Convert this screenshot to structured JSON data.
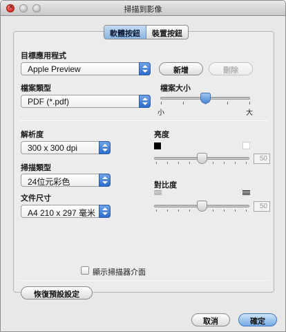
{
  "window": {
    "title": "掃描到影像"
  },
  "tabs": [
    {
      "label": "軟體按鈕",
      "selected": true
    },
    {
      "label": "裝置按鈕",
      "selected": false
    }
  ],
  "target_app": {
    "label": "目標應用程式",
    "value": "Apple Preview",
    "add_button": "新增",
    "delete_button": "刪除"
  },
  "file_type": {
    "label": "檔案類型",
    "value": "PDF (*.pdf)"
  },
  "file_size": {
    "label": "檔案大小",
    "small_label": "小",
    "large_label": "大",
    "level": 0.45
  },
  "resolution": {
    "label": "解析度",
    "value": "300 x 300 dpi"
  },
  "scan_type": {
    "label": "掃描類型",
    "value": "24位元彩色"
  },
  "document_size": {
    "label": "文件尺寸",
    "value": "A4  210 x 297 毫米"
  },
  "brightness": {
    "label": "亮度",
    "value": "50"
  },
  "contrast": {
    "label": "對比度",
    "value": "50"
  },
  "show_scanner_interface": {
    "label": "顯示掃描器介面",
    "checked": false
  },
  "restore_defaults": "恢復預設設定",
  "footer": {
    "cancel": "取消",
    "ok": "確定"
  },
  "colors": {
    "accent": "#4a86d4",
    "window_bg": "#e8e8e8"
  },
  "icons": [
    "close-icon",
    "minimize-icon",
    "zoom-icon",
    "popup-arrows-icon",
    "black-square-icon",
    "white-square-icon",
    "low-contrast-icon",
    "high-contrast-icon"
  ]
}
